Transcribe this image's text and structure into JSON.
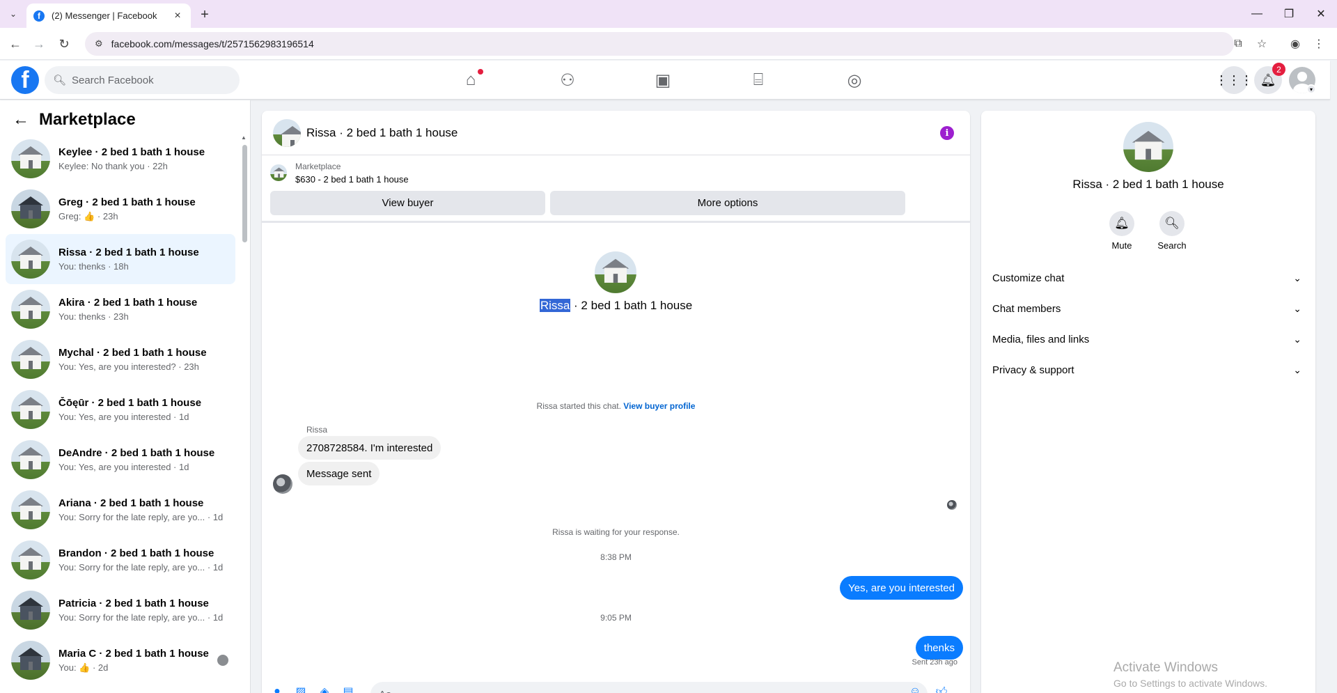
{
  "browser": {
    "tab_title": "(2) Messenger | Facebook",
    "url": "facebook.com/messages/t/2571562983196514"
  },
  "fb": {
    "search_placeholder": "Search Facebook",
    "notif_count": "2"
  },
  "sidebar": {
    "title": "Marketplace",
    "conversations": [
      {
        "name": "Keylee · 2 bed 1 bath 1 house",
        "preview": "Keylee: No thank you · 22h",
        "style": "light",
        "active": false
      },
      {
        "name": "Greg · 2 bed 1 bath 1 house",
        "preview": "Greg: 👍 · 23h",
        "style": "dark",
        "active": false
      },
      {
        "name": "Rissa · 2 bed 1 bath 1 house",
        "preview": "You: thenks · 18h",
        "style": "light",
        "active": true
      },
      {
        "name": "Akira · 2 bed 1 bath 1 house",
        "preview": "You: thenks · 23h",
        "style": "light",
        "active": false
      },
      {
        "name": "Mychal · 2 bed 1 bath 1 house",
        "preview": "You: Yes, are you interested? · 23h",
        "style": "light",
        "active": false
      },
      {
        "name": "Čōęūr · 2 bed 1 bath 1 house",
        "preview": "You: Yes, are you interested · 1d",
        "style": "light",
        "active": false
      },
      {
        "name": "DeAndre · 2 bed 1 bath 1 house",
        "preview": "You: Yes, are you interested · 1d",
        "style": "light",
        "active": false
      },
      {
        "name": "Ariana · 2 bed 1 bath 1 house",
        "preview": "You: Sorry for the late reply, are yo... · 1d",
        "style": "light",
        "active": false
      },
      {
        "name": "Brandon · 2 bed 1 bath 1 house",
        "preview": "You: Sorry for the late reply, are yo... · 1d",
        "style": "light",
        "active": false
      },
      {
        "name": "Patricia · 2 bed 1 bath 1 house",
        "preview": "You: Sorry for the late reply, are yo... · 1d",
        "style": "dark",
        "active": false
      },
      {
        "name": "Maria C · 2 bed 1 bath 1 house",
        "preview": "You: 👍 · 2d",
        "style": "dark",
        "active": false
      }
    ]
  },
  "chat": {
    "title": "Rissa · 2 bed 1 bath 1 house",
    "marketplace_label": "Marketplace",
    "marketplace_item": "$630 - 2 bed 1 bath 1 house",
    "view_buyer": "View buyer",
    "more_options": "More options",
    "intro_name": "Rissa",
    "intro_rest": " · 2 bed 1 bath 1 house",
    "started_text": "Rissa started this chat.",
    "buyer_profile_link": "View buyer profile",
    "sender": "Rissa",
    "msg_in_1": "2708728584. I'm interested",
    "msg_in_2": "Message sent",
    "waiting_text": "Rissa is waiting for your response.",
    "time_1": "8:38 PM",
    "msg_out_1": "Yes, are you interested",
    "time_2": "9:05 PM",
    "msg_out_2": "thenks",
    "sent_status": "Sent 23h ago",
    "composer_placeholder": "Aa"
  },
  "info_panel": {
    "title": "Rissa · 2 bed 1 bath 1 house",
    "mute": "Mute",
    "search": "Search",
    "sections": [
      "Customize chat",
      "Chat members",
      "Media, files and links",
      "Privacy & support"
    ]
  },
  "watermark": {
    "line1": "Activate Windows",
    "line2": "Go to Settings to activate Windows."
  },
  "colors": {
    "fb_blue": "#1877f2",
    "message_blue": "#0a7cff",
    "active_row": "#ebf5ff",
    "info_purple": "#9d1fcf",
    "badge_red": "#e41e3f"
  },
  "icons": {
    "home": "home-icon",
    "friends": "friends-icon",
    "video": "video-icon",
    "marketplace": "marketplace-icon",
    "groups": "groups-icon",
    "menu": "grid-menu-icon",
    "notifications": "bell-icon"
  }
}
